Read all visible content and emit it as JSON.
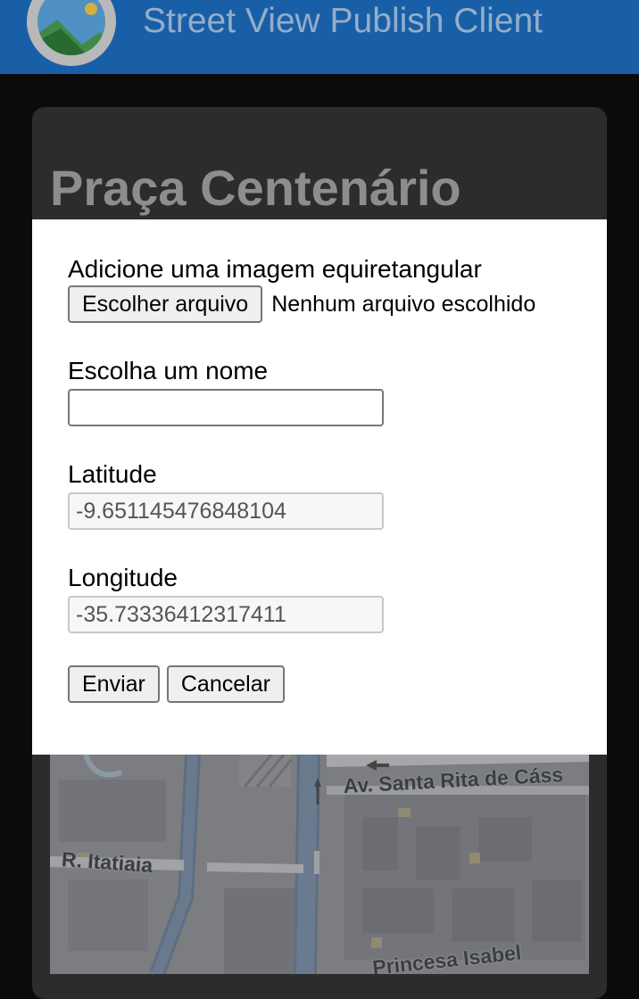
{
  "header": {
    "app_title": "Street View Publish Client",
    "logo_icon": "landscape-logo-icon",
    "background_color": "#1d6dbf"
  },
  "card": {
    "place_title": "Praça Centenário"
  },
  "dialog": {
    "file": {
      "label": "Adicione uma imagem equiretangular",
      "choose_button": "Escolher arquivo",
      "status": "Nenhum arquivo escolhido"
    },
    "name": {
      "label": "Escolha um nome",
      "value": ""
    },
    "latitude": {
      "label": "Latitude",
      "value": "-9.651145476848104"
    },
    "longitude": {
      "label": "Longitude",
      "value": "-35.73336412317411"
    },
    "actions": {
      "submit_label": "Enviar",
      "cancel_label": "Cancelar"
    }
  },
  "map": {
    "street_labels": {
      "santa_rita": "Av. Santa Rita de Cáss",
      "itatiaia": "R. Itatiaia",
      "isabel": "Princesa Isabel"
    }
  }
}
